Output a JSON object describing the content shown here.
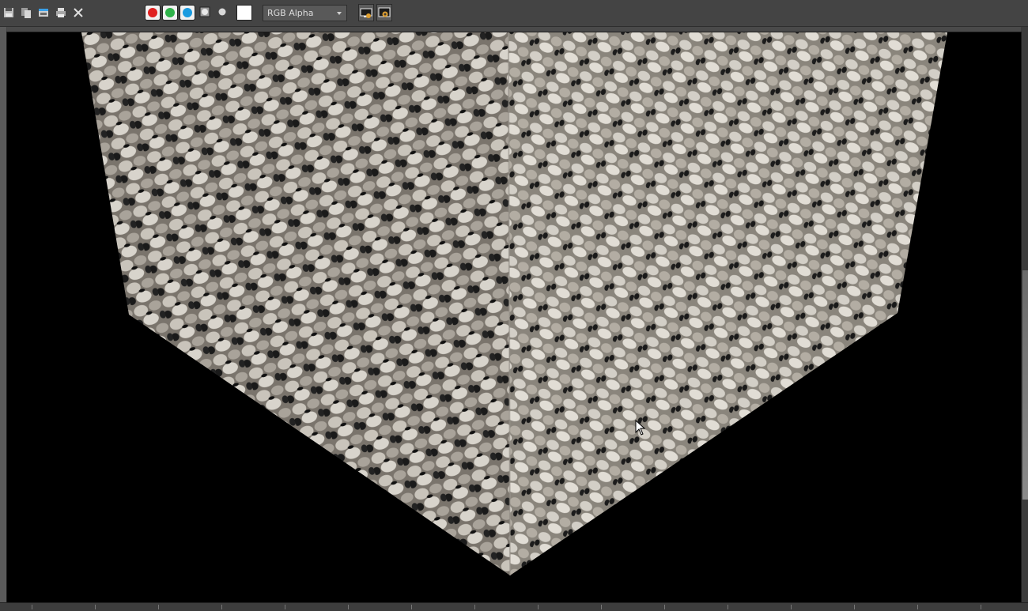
{
  "toolbar": {
    "icons": [
      "save-icon",
      "clone-icon",
      "copy-icon",
      "print-icon",
      "close-icon"
    ],
    "channels": [
      {
        "name": "red-channel",
        "color": "#e02020"
      },
      {
        "name": "green-channel",
        "color": "#2fb34a"
      },
      {
        "name": "blue-channel",
        "color": "#1a9be0"
      }
    ],
    "alpha_icon": "alpha-channel-icon",
    "mono_icon": "monochrome-icon",
    "swatch_color": "#ffffff",
    "channel_select": "RGB Alpha",
    "image_buttons": [
      "display-image-icon",
      "image-info-icon"
    ]
  },
  "viewport": {
    "background": "#000000",
    "content": "rendered-textured-cube"
  }
}
